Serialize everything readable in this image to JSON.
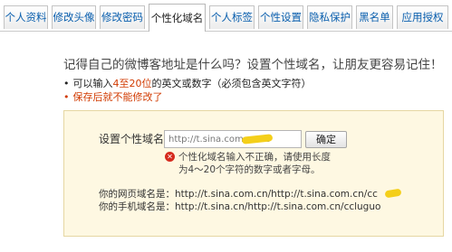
{
  "tabs": [
    {
      "label": "个人资料",
      "active": false
    },
    {
      "label": "修改头像",
      "active": false
    },
    {
      "label": "修改密码",
      "active": false
    },
    {
      "label": "个性化域名",
      "active": true
    },
    {
      "label": "个人标签",
      "active": false
    },
    {
      "label": "个性设置",
      "active": false
    },
    {
      "label": "隐私保护",
      "active": false
    },
    {
      "label": "黑名单",
      "active": false
    },
    {
      "label": "应用授权",
      "active": false
    }
  ],
  "main": {
    "heading": "记得自己的微博客地址是什么吗？设置个性域名，让朋友更容易记住！",
    "rule1_prefix": "可以输入",
    "rule1_range": "4至20位",
    "rule1_suffix": "的英文或数字（必须包含英文字符）",
    "rule2": "保存后就不能修改了"
  },
  "form": {
    "label": "设置个性域名：",
    "input_value": "http://t.sina.com.cn/cc",
    "confirm_label": "确定",
    "error_text": "个性化域名输入不正确，请使用长度为4～20个字符的数字或者字母。",
    "web_url_label": "你的网页域名是：",
    "web_url": "http://t.sina.com.cn/http://t.sina.com.cn/cc",
    "mobile_url_label": "你的手机域名是：",
    "mobile_url": "http://t.sina.cn/http://t.sina.com.cn/ccluguo"
  },
  "colors": {
    "tab_link": "#0a5fae",
    "highlight_red": "#d13a00",
    "box_bg": "#fef8e2",
    "box_border": "#e6d7a2",
    "error_red": "#d52b1e"
  }
}
